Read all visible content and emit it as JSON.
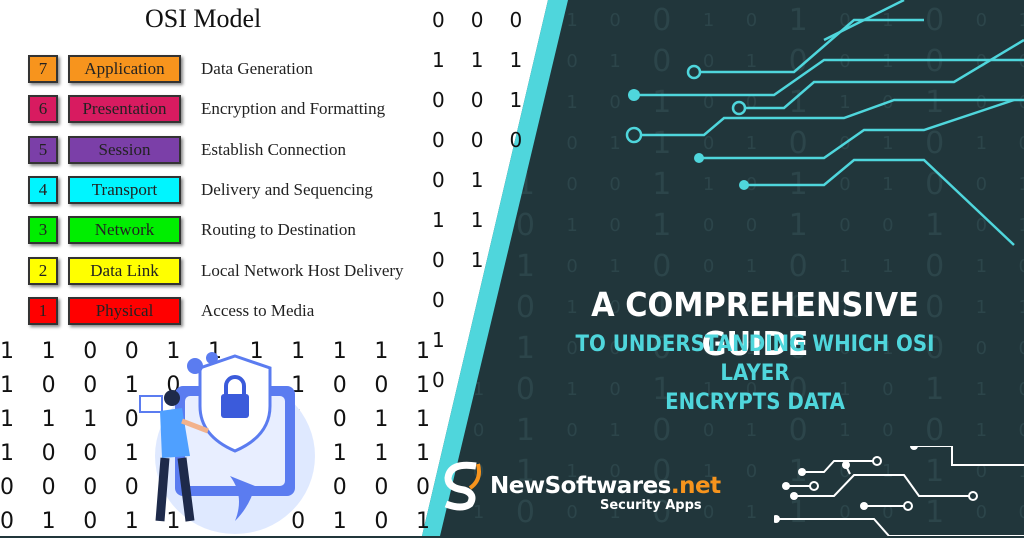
{
  "osi": {
    "title": "OSI Model",
    "layers": [
      {
        "number": "7",
        "name": "Application",
        "description": "Data Generation",
        "color": "#f7941d"
      },
      {
        "number": "6",
        "name": "Presentation",
        "description": "Encryption and Formatting",
        "color": "#d81b60"
      },
      {
        "number": "5",
        "name": "Session",
        "description": "Establish Connection",
        "color": "#7b3fa8"
      },
      {
        "number": "4",
        "name": "Transport",
        "description": "Delivery and Sequencing",
        "color": "#00f5ff"
      },
      {
        "number": "3",
        "name": "Network",
        "description": "Routing to Destination",
        "color": "#00ee00"
      },
      {
        "number": "2",
        "name": "Data Link",
        "description": "Local Network Host Delivery",
        "color": "#ffff00"
      },
      {
        "number": "1",
        "name": "Physical",
        "description": "Access to Media",
        "color": "#ff0000"
      }
    ]
  },
  "headline": {
    "line1": "A COMPREHENSIVE GUIDE",
    "line2": "TO UNDERSTANDING WHICH OSI LAYER",
    "line3": "ENCRYPTS DATA"
  },
  "brand": {
    "name_main": "NewSoftwares",
    "name_tld": ".net",
    "tagline": "Security Apps",
    "accent": "#f7941d"
  },
  "colors": {
    "background": "#21363b",
    "cyan": "#4fd6dc"
  },
  "binary": {
    "dark_rows": [
      "1 0 1 1 0 0 1 0 1 0 1 0 0 1",
      "0 1 0 0 1 0 0 1 0 0 1 0 0 0",
      "1 0 1 1 0 1 0 0 1 1 0 1 0 0",
      "1 1 0 0 1 1 0 1 0 0 1 0 1 0",
      "0 0 1 0 0 1 1 0 1 0 1 0 0 1",
      "1 0 0 1 0 1 0 0 1 0 0 1 0 1",
      "0 1 1 0 1 0 0 1 0 1 1 0 1 0",
      "1 0 0 1 0 1 1 0 0 1 0 0 1 1",
      "0 0 1 0 0 0 0 1 0 0 1 0 0 0",
      "1 1 0 1 0 1 1 0 0 1 0 1 1 0",
      "0 0 1 0 1 0 0 1 0 1 0 0 1 0",
      "1 0 1 1 0 0 1 0 1 0 1 1 0 1",
      "0 1 0 0 1 0 0 1 1 0 0 1 0 0"
    ],
    "column_rows": [
      "0 0 0",
      "1 1 1",
      "0 0 1",
      "0 0 0",
      "0 1",
      "1 1",
      "0 1",
      "0",
      "1",
      "0"
    ],
    "bottom_rows": [
      "1 1 0 0 1 1 1 1 1 1 1",
      "1 0 0 1 0 1 1 1 0 0 1",
      "1 1 1 0 1 1 1 1 0 1 1",
      "1 0 0 1 0 1 0 0 1 1 1",
      "0 0 0 0 0 1 1 0 0 0 0",
      "0 1 0 1 1 1 1 0 1 0 1"
    ]
  }
}
